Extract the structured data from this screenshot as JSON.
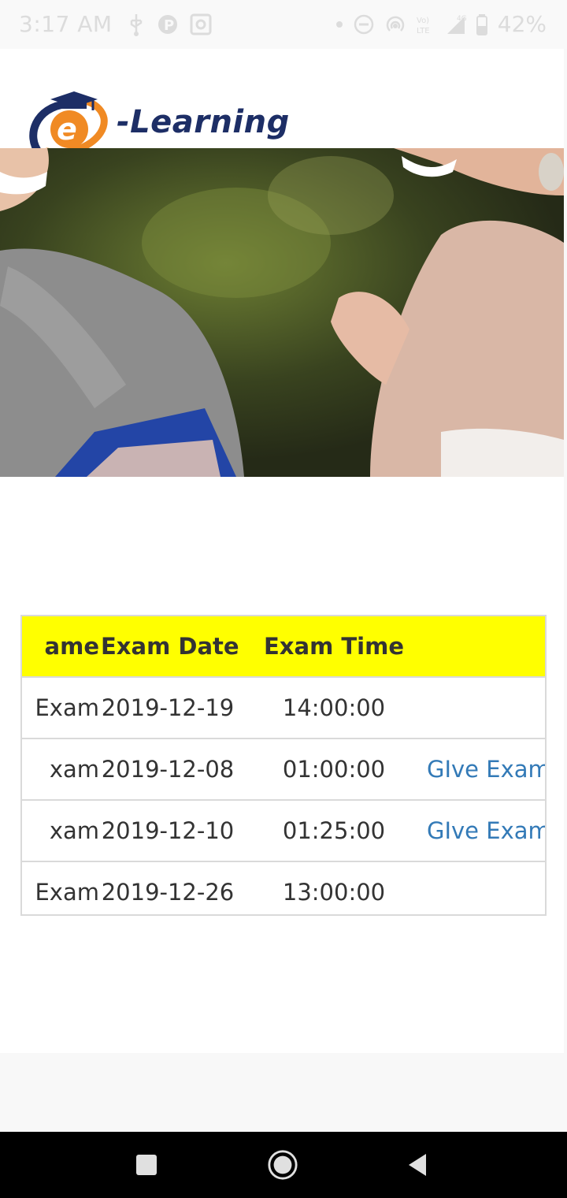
{
  "status_bar": {
    "time": "3:17 AM",
    "battery": "42%"
  },
  "logo": {
    "mark_letter": "e",
    "text": "-Learning"
  },
  "exam_table": {
    "headers": [
      "ame",
      "Exam Date",
      "Exam Time",
      ""
    ],
    "rows": [
      {
        "name": "Exam",
        "date": "2019-12-19",
        "time": "14:00:00",
        "action": ""
      },
      {
        "name": "xam",
        "date": "2019-12-08",
        "time": "01:00:00",
        "action": "GIve Exam"
      },
      {
        "name": "xam",
        "date": "2019-12-10",
        "time": "01:25:00",
        "action": "GIve Exam"
      },
      {
        "name": "Exam",
        "date": "2019-12-26",
        "time": "13:00:00",
        "action": ""
      }
    ]
  },
  "colors": {
    "header_bg": "#ffff00",
    "link": "#337ab7",
    "logo_navy": "#1d2e66",
    "logo_orange": "#f08a24"
  },
  "icons": {
    "status_left": [
      "usb-icon",
      "parking-icon",
      "screenshot-icon"
    ],
    "status_right": [
      "dot-icon",
      "do-not-disturb-icon",
      "hotspot-icon",
      "volte-icon",
      "signal-icon",
      "battery-icon"
    ],
    "nav": [
      "recents-icon",
      "home-icon",
      "back-icon"
    ]
  }
}
